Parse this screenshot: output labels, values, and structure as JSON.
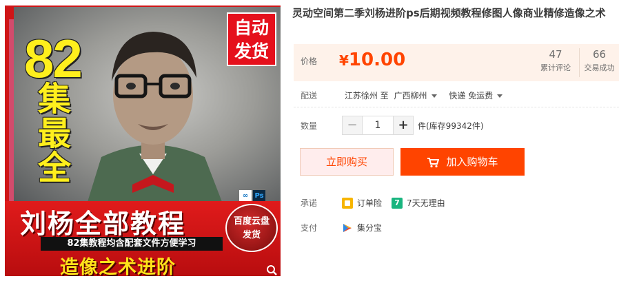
{
  "gallery": {
    "badge_number": "82",
    "vertical_title": "集最全",
    "auto_ship": [
      "自动",
      "发货"
    ],
    "ps_icon": "Ps",
    "main_headline": "刘杨全部教程",
    "sub_headline": "82集教程均含配套文件方便学习",
    "bottom_headline": "造像之术进阶",
    "baidu_badge": [
      "百度云盘",
      "发货"
    ],
    "zoom_icon": "magnifier-icon"
  },
  "product": {
    "title": "灵动空间第二季刘杨进阶ps后期视频教程修图人像商业精修造像之术"
  },
  "price": {
    "label": "价格",
    "currency": "¥",
    "value": "10.00",
    "reviews_count": "47",
    "reviews_label": "累计评论",
    "deals_count": "66",
    "deals_label": "交易成功"
  },
  "shipping": {
    "label": "配送",
    "from": "江苏徐州 至",
    "to": "广西柳州",
    "method": "快递 免运费"
  },
  "quantity": {
    "label": "数量",
    "minus": "−",
    "value": "1",
    "plus": "+",
    "stock": "件(库存99342件)"
  },
  "actions": {
    "buy_now": "立即购买",
    "add_to_cart": "加入购物车"
  },
  "promise": {
    "label": "承诺",
    "items": [
      "订单险",
      "7天无理由"
    ]
  },
  "payment": {
    "label": "支付",
    "method": "集分宝"
  },
  "colors": {
    "accent": "#ff4400",
    "price_bg": "#fef2ea",
    "buy_bg": "#ffeded"
  }
}
